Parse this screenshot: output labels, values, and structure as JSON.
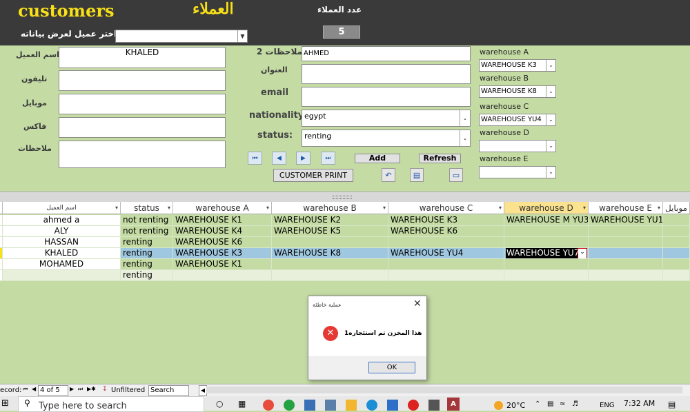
{
  "header": {
    "title_en": "customers",
    "title_ar": "العملاء",
    "count_label": "عدد العملاء",
    "count_value": "5",
    "select_label": "اختر عميل لعرض بياناته",
    "select_value": ""
  },
  "form": {
    "name_label": "اسم العميل",
    "name_value": "KHALED",
    "phone_label": "تليفون",
    "phone_value": "",
    "mobile_label": "موبايل",
    "mobile_value": "",
    "fax_label": "فاكس",
    "fax_value": "",
    "notes_label": "ملاحظات",
    "notes_value": "",
    "notes2_label": "ملاحظات 2",
    "notes2_value": "AHMED",
    "address_label": "العنوان",
    "address_value": "",
    "email_label": "email",
    "email_value": "",
    "nationality_label": "nationality",
    "nationality_value": "egypt",
    "status_label": "status:",
    "status_value": "renting",
    "add_label": "Add",
    "refresh_label": "Refresh",
    "print_label": "CUSTOMER PRINT"
  },
  "warehouses": [
    {
      "label": "warehouse A",
      "value": "WAREHOUSE K3"
    },
    {
      "label": "warehouse B",
      "value": "WAREHOUSE K8"
    },
    {
      "label": "warehouse C",
      "value": "WAREHOUSE YU4"
    },
    {
      "label": "warehouse D",
      "value": ""
    },
    {
      "label": "warehouse E",
      "value": ""
    }
  ],
  "grid": {
    "headers": [
      "اسم العميل",
      "status",
      "warehouse A",
      "warehouse B",
      "warehouse C",
      "warehouse D",
      "warehouse E",
      "موبايل"
    ],
    "rows": [
      [
        "ahmed a",
        "not renting",
        "WAREHOUSE K1",
        "WAREHOUSE K2",
        "WAREHOUSE K3",
        "WAREHOUSE M YU3",
        "WAREHOUSE YU1"
      ],
      [
        "ALY",
        "not renting",
        "WAREHOUSE K4",
        "WAREHOUSE K5",
        "WAREHOUSE K6",
        "",
        ""
      ],
      [
        "HASSAN",
        "renting",
        "WAREHOUSE K6",
        "",
        "",
        "",
        ""
      ],
      [
        "KHALED",
        "renting",
        "WAREHOUSE K3",
        "WAREHOUSE K8",
        "WAREHOUSE YU4",
        "WAREHOUSE YU7",
        ""
      ],
      [
        "MOHAMED",
        "renting",
        "WAREHOUSE K1",
        "",
        "",
        "",
        ""
      ],
      [
        "",
        "renting",
        "",
        "",
        "",
        "",
        ""
      ]
    ]
  },
  "navbar": {
    "record_label": "ecord:",
    "record_pos": "4 of 5",
    "filter_label": "Unfiltered",
    "search_label": "Search"
  },
  "dialog": {
    "title": "عملية خاطئة",
    "message": "هذا المخزن تم استئجاره1",
    "ok_label": "OK"
  },
  "taskbar": {
    "search_placeholder": "Type here to search",
    "temp": "20°C",
    "lang": "ENG",
    "time": "7:32 AM"
  },
  "colors": {
    "header_bg": "#3a3a3a",
    "title_yellow": "#f7e017",
    "form_bg": "#c4dba4",
    "selected_row": "#9fc8e0",
    "error_red": "#e53935"
  }
}
